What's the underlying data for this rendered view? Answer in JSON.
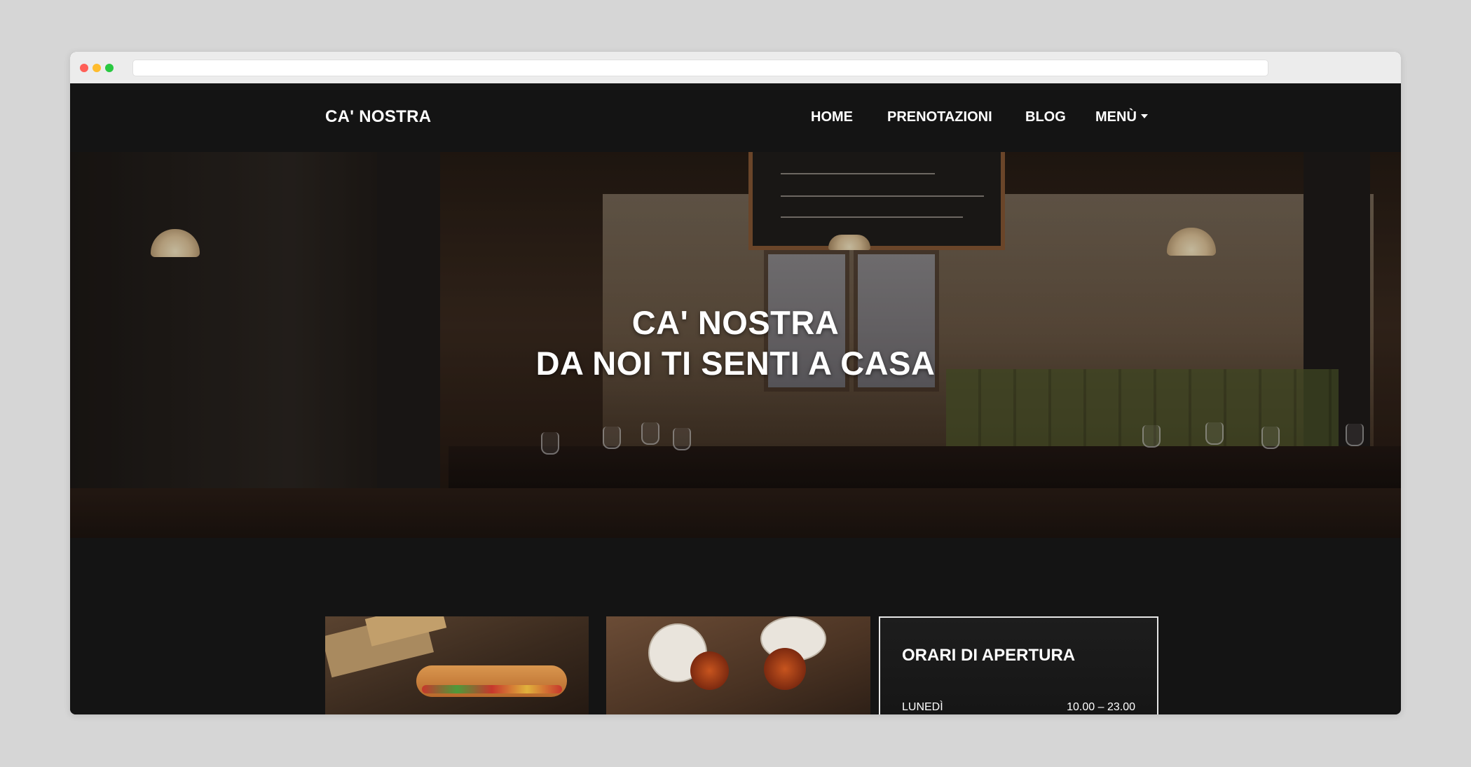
{
  "nav": {
    "brand": "CA' NOSTRA",
    "links": [
      {
        "label": "HOME"
      },
      {
        "label": "PRENOTAZIONI"
      },
      {
        "label": "BLOG"
      },
      {
        "label": "MENÙ"
      }
    ]
  },
  "hero": {
    "line1": "CA' NOSTRA",
    "line2": "DA NOI TI SENTI A CASA"
  },
  "hours": {
    "title": "ORARI DI APERTURA",
    "rows": [
      {
        "day": "LUNEDÌ",
        "time": "10.00 – 23.00"
      }
    ]
  },
  "colors": {
    "background": "#141414",
    "text": "#ffffff",
    "page": "#d6d6d6"
  }
}
